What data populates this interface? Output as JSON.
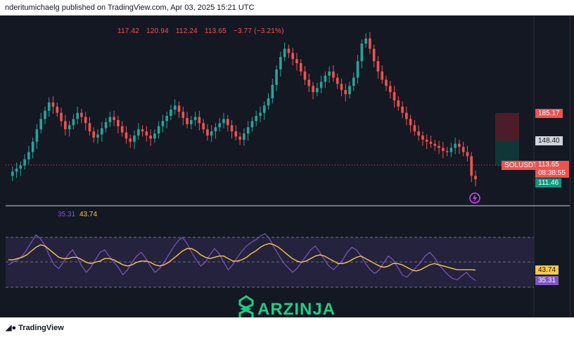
{
  "header": {
    "attribution": "nderitumichaelg published on TradingView.com, Apr 03, 2025 15:21 UTC"
  },
  "ohlc": {
    "open": "117.42",
    "high": "120.94",
    "low": "112.24",
    "close": "113.65",
    "change": "−3.77 (−3.21%)"
  },
  "price_scale": {
    "target_label": "185.17",
    "entry_label": "148.40",
    "symbol_label": "SOLUSDT",
    "current_price": "113.65",
    "countdown": "08:38:55",
    "stop_label": "111.46"
  },
  "rsi": {
    "rsi_value": "35.31",
    "ma_value": "43.74",
    "rsi_color": "#7e57c2",
    "ma_color": "#f7c948"
  },
  "footer": {
    "logo_text": "TradingView",
    "logo_icon": "tradingview-logo-icon"
  },
  "watermark": {
    "text": "ARZINJA",
    "color": "#1bd087",
    "icon": "arzinja-logo-icon"
  },
  "colors": {
    "up": "#26a69a",
    "down": "#ef5350",
    "background": "#141823"
  },
  "chart_data": {
    "type": "candlestick",
    "symbol": "SOLUSDT",
    "close_series": [
      117,
      121,
      124,
      127,
      133,
      140,
      150,
      162,
      172,
      180,
      188,
      184,
      178,
      170,
      162,
      166,
      172,
      178,
      174,
      168,
      160,
      154,
      157,
      163,
      169,
      174,
      171,
      165,
      159,
      153,
      150,
      156,
      162,
      160,
      156,
      153,
      158,
      165,
      170,
      175,
      181,
      185,
      179,
      173,
      167,
      171,
      174,
      168,
      162,
      156,
      160,
      164,
      168,
      172,
      166,
      160,
      155,
      152,
      158,
      164,
      170,
      175,
      178,
      185,
      192,
      205,
      220,
      232,
      240,
      236,
      230,
      226,
      218,
      210,
      204,
      198,
      202,
      208,
      214,
      218,
      212,
      206,
      200,
      196,
      204,
      212,
      228,
      245,
      250,
      240,
      228,
      218,
      210,
      204,
      198,
      190,
      184,
      178,
      172,
      166,
      160,
      156,
      152,
      150,
      148,
      146,
      144,
      141,
      140,
      144,
      148,
      145,
      140,
      136,
      117,
      113.65
    ],
    "rsi_series": [
      48,
      50,
      52,
      55,
      60,
      66,
      72,
      69,
      63,
      55,
      48,
      45,
      50,
      56,
      60,
      54,
      47,
      42,
      46,
      52,
      58,
      60,
      55,
      50,
      46,
      40,
      44,
      50,
      55,
      58,
      53,
      47,
      42,
      45,
      50,
      56,
      62,
      67,
      70,
      65,
      58,
      52,
      47,
      50,
      56,
      61,
      57,
      50,
      44,
      48,
      54,
      59,
      63,
      66,
      68,
      71,
      73,
      69,
      62,
      56,
      50,
      46,
      42,
      45,
      50,
      55,
      60,
      63,
      58,
      52,
      47,
      44,
      48,
      52,
      58,
      62,
      60,
      55,
      49,
      44,
      41,
      44,
      50,
      55,
      52,
      46,
      40,
      38,
      42,
      46,
      50,
      55,
      58,
      54,
      48,
      44,
      40,
      37,
      36,
      39,
      42,
      38,
      35.31
    ],
    "ma_series": [
      52,
      52,
      53,
      54,
      56,
      59,
      62,
      64,
      63,
      60,
      57,
      54,
      53,
      53,
      54,
      54,
      52,
      50,
      49,
      50,
      51,
      53,
      53,
      52,
      50,
      48,
      47,
      48,
      50,
      51,
      51,
      50,
      48,
      47,
      48,
      50,
      53,
      56,
      59,
      61,
      61,
      59,
      56,
      54,
      53,
      54,
      55,
      55,
      53,
      51,
      51,
      52,
      54,
      57,
      59,
      62,
      64,
      65,
      64,
      62,
      59,
      56,
      53,
      51,
      50,
      51,
      53,
      55,
      56,
      55,
      53,
      51,
      49,
      49,
      50,
      52,
      54,
      55,
      53,
      51,
      49,
      47,
      46,
      47,
      49,
      49,
      48,
      46,
      44,
      43,
      44,
      46,
      48,
      49,
      48,
      47,
      46,
      45,
      44,
      44,
      44,
      44,
      43.74
    ],
    "rsi_bands": [
      30,
      50,
      70
    ],
    "rsi_peak_label": "35.31",
    "ma_peak_label": "43.74"
  }
}
